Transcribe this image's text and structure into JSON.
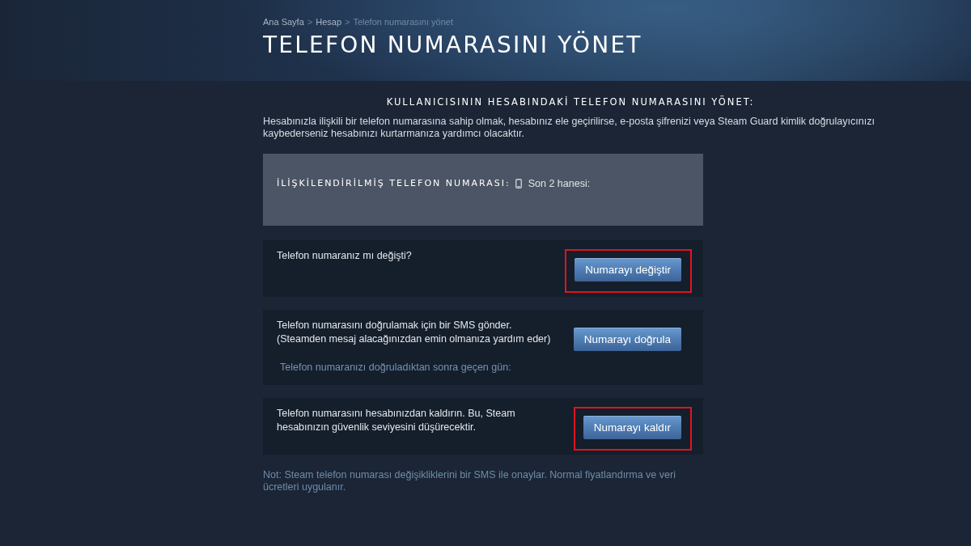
{
  "breadcrumb": [
    {
      "label": "Ana Sayfa",
      "current": false,
      "separator": ">"
    },
    {
      "label": "Hesap",
      "current": false,
      "separator": ">"
    },
    {
      "label": "Telefon numarasını yönet",
      "current": true
    }
  ],
  "title": "TELEFON NUMARASINI YÖNET",
  "section_heading": "KULLANICISININ HESABINDAKİ TELEFON NUMARASINI YÖNET:",
  "intro": "Hesabınızla ilişkili bir telefon numarasına sahip olmak, hesabınız ele geçirilirse, e-posta şifrenizi veya Steam Guard kimlik doğrulayıcınızı kaybederseniz hesabınızı kurtarmanıza yardımcı olacaktır.",
  "phone_panel": {
    "label": "İLİŞKİLENDİRİLMİŞ TELEFON NUMARASI:",
    "digits_label": "Son 2 hanesi:"
  },
  "actions": [
    {
      "text": "Telefon numaranız mı değişti?",
      "button": "Numarayı değiştir",
      "highlighted": true
    },
    {
      "text": "Telefon numarasını doğrulamak için bir SMS gönder. (Steamden mesaj alacağınızdan emin olmanıza yardım eder)",
      "button": "Numarayı doğrula",
      "highlighted": false,
      "subtext": "Telefon numaranızı doğruladıktan sonra geçen gün:"
    },
    {
      "text": "Telefon numarasını hesabınızdan kaldırın. Bu, Steam hesabınızın güvenlik seviyesini düşürecektir.",
      "button": "Numarayı kaldır",
      "highlighted": true
    }
  ],
  "note": "Not: Steam telefon numarası değişikliklerini bir SMS ile onaylar. Normal fiyatlandırma ve veri ücretleri uygulanır."
}
